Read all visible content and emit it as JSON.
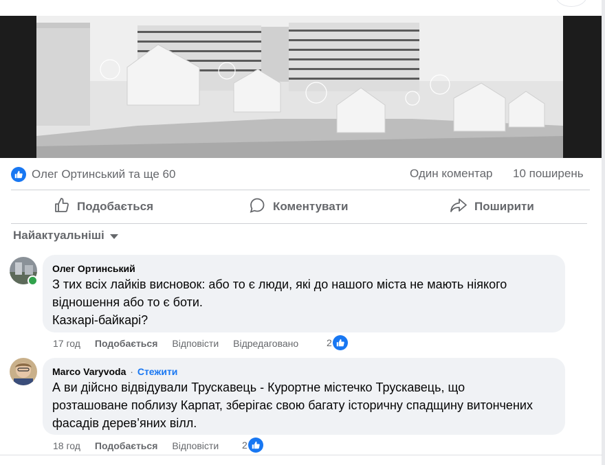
{
  "post": {
    "reactions_text": "Олег Ортинський та ще 60",
    "comments_count": "Один коментар",
    "shares_count": "10 поширень"
  },
  "actions": {
    "like": "Подобається",
    "comment": "Коментувати",
    "share": "Поширити"
  },
  "sort": {
    "label": "Найактуальніші"
  },
  "comments": [
    {
      "author": "Олег Ортинський",
      "lines": [
        "З тих всіх лайків висновок: або то є люди, які до нашого міста не мають ніякого",
        "відношення або то є боти.",
        "Казкарі-байкарі?"
      ],
      "time": "17 год",
      "like": "Подобається",
      "reply": "Відповісти",
      "edited": "Відредаговано",
      "reactions": "2"
    },
    {
      "author": "Marco Varyvoda",
      "separator": "·",
      "follow": "Стежити",
      "lines": [
        "А ви дійсно відвідували Трускавець - Курортне містечко Трускавець, що",
        "розташоване поблизу Карпат, зберігає свою багату історичну спадщину витончених",
        "фасадів дерев’яних вілл."
      ],
      "time": "18 год",
      "like": "Подобається",
      "reply": "Відповісти",
      "reactions": "2"
    }
  ],
  "colors": {
    "accent": "#1877f2",
    "secondary_text": "#65676b",
    "bubble_bg": "#f0f2f5",
    "online": "#31a24c"
  }
}
